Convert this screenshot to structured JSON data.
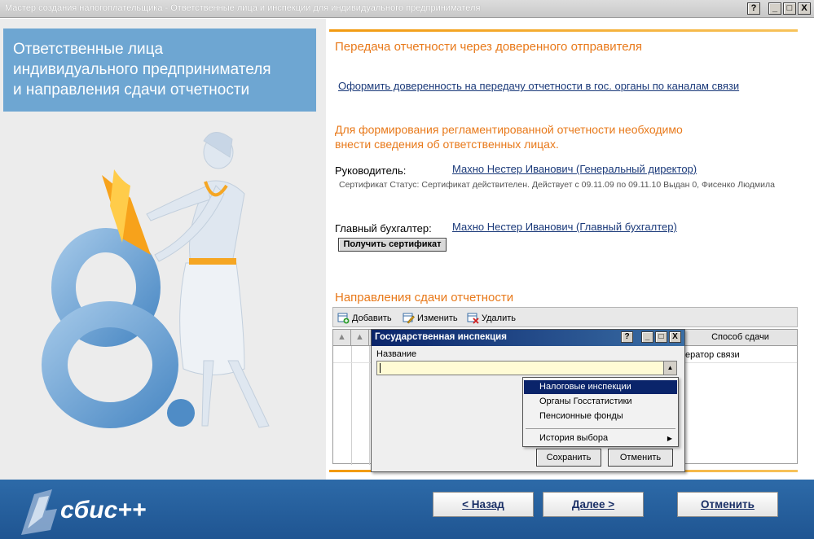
{
  "window": {
    "title": "Мастер создания налогоплательщика - Ответственные лица и инспекции для индивидуального предпринимателя",
    "help_label": "?",
    "minimize_label": "_",
    "maximize_label": "□",
    "close_label": "X"
  },
  "left": {
    "header_line1": "Ответственные лица",
    "header_line2": "индивидуального предпринимателя",
    "header_line3": "и направления сдачи отчетности"
  },
  "right": {
    "section1_title": "Передача отчетности через доверенного отправителя",
    "proxy_link": "Оформить доверенность на передачу отчетности в гос. органы по каналам связи",
    "section2_title_line1": "Для формирования регламентированной отчетности необходимо",
    "section2_title_line2": "внести сведения об ответственных лицах.",
    "director_label": "Руководитель:",
    "director_link": "Махно Нестер Иванович (Генеральный директор)",
    "certificate_status": "Сертификат Статус: Сертификат действителен. Действует с 09.11.09 по 09.11.10 Выдан 0, Фисенко Людмила",
    "accountant_label": "Главный бухгалтер:",
    "accountant_link": "Махно Нестер Иванович (Главный бухгалтер)",
    "get_cert_button": "Получить сертификат",
    "section3_title": "Направления сдачи отчетности"
  },
  "toolbar": {
    "add_label": "Добавить",
    "edit_label": "Изменить",
    "delete_label": "Удалить"
  },
  "grid": {
    "col_method": "Способ сдачи",
    "row1_method": "ератор связи"
  },
  "dialog": {
    "title": "Государственная инспекция",
    "name_label": "Название",
    "name_value": "",
    "save_label": "Сохранить",
    "cancel_label": "Отменить"
  },
  "menu": {
    "items": [
      "Налоговые инспекции",
      "Органы Госстатистики",
      "Пенсионные фонды"
    ],
    "history_label": "История выбора"
  },
  "footer": {
    "logo_text": "сбис++",
    "back_label": "< Назад",
    "next_label": "Далее >",
    "cancel_label": "Отменить"
  },
  "colors": {
    "accent_orange": "#e8791a",
    "link_blue": "#1b3a7a",
    "header_blue": "#6ea6d2",
    "footer_blue": "#2d6aa8",
    "selection_navy": "#0a246a",
    "input_yellow": "#fffbd5"
  }
}
